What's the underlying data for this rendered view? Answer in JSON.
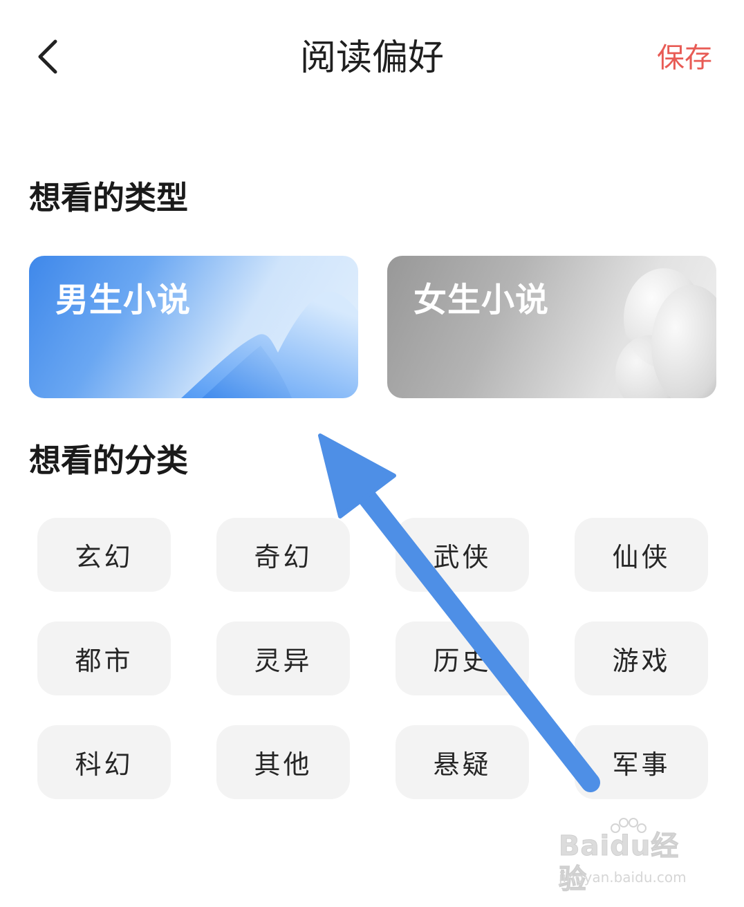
{
  "header": {
    "title": "阅读偏好",
    "save_label": "保存",
    "back_icon": "chevron-left-icon"
  },
  "colors": {
    "accent_save": "#e85b55",
    "male_card": "#4a90ec",
    "female_card": "#a8a8a8",
    "chip_bg": "#f3f3f3",
    "arrow": "#4e8fe6"
  },
  "sections": {
    "types_title": "想看的类型",
    "categories_title": "想看的分类"
  },
  "types": [
    {
      "label": "男生小说"
    },
    {
      "label": "女生小说"
    }
  ],
  "categories": [
    "玄幻",
    "奇幻",
    "武侠",
    "仙侠",
    "都市",
    "灵异",
    "历史",
    "游戏",
    "科幻",
    "其他",
    "悬疑",
    "军事"
  ],
  "watermark": {
    "brand": "Baidu经验",
    "url": "jingyan.baidu.com"
  }
}
